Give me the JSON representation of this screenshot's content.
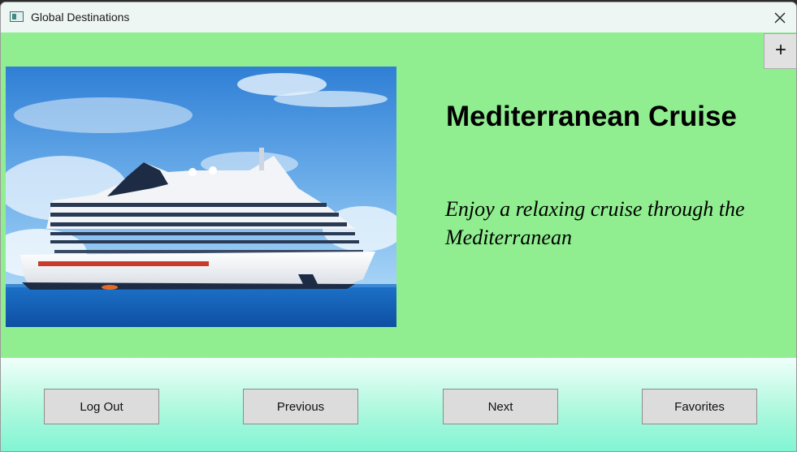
{
  "window": {
    "title": "Global Destinations"
  },
  "toolbar": {
    "add_label": "+"
  },
  "destination": {
    "title": "Mediterranean Cruise",
    "description": "Enjoy a relaxing cruise through the Mediterranean",
    "image_alt": "Cruise ship at sea"
  },
  "buttons": {
    "logout": "Log Out",
    "previous": "Previous",
    "next": "Next",
    "favorites": "Favorites"
  },
  "colors": {
    "content_bg": "#90ee90",
    "footer_bg_top": "#f0fffa",
    "footer_bg_bottom": "#7ff5d2",
    "button_bg": "#dcdcdc"
  }
}
